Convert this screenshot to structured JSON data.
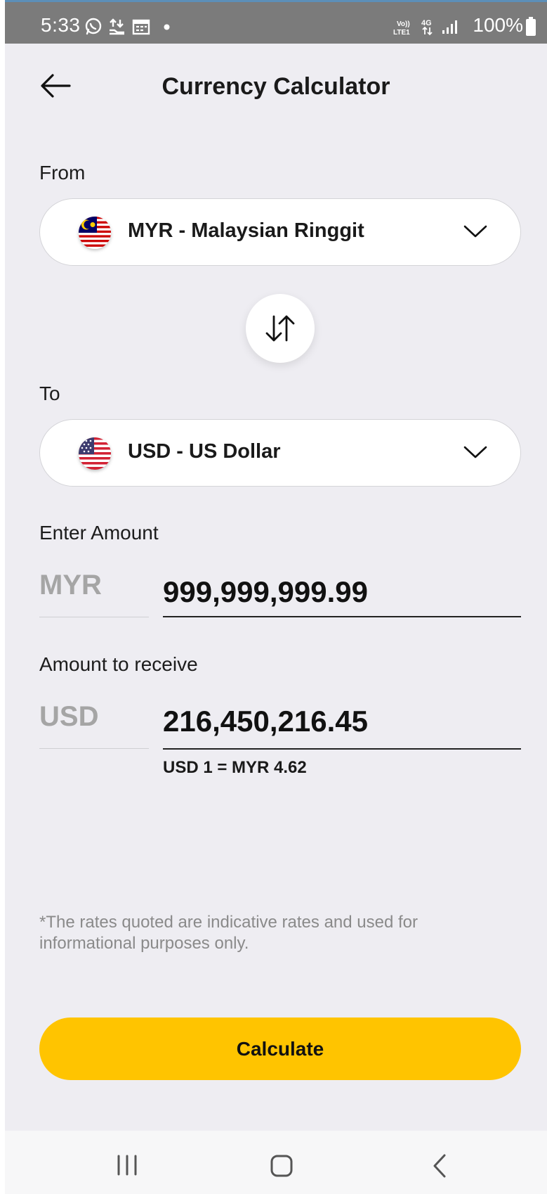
{
  "status_bar": {
    "time": "5:33",
    "network": "4G",
    "volte": "Vo)) LTE1",
    "battery": "100%",
    "icons": [
      "whatsapp-icon",
      "transfer-icon",
      "calendar-icon",
      "dot-icon",
      "volte-icon",
      "4g-icon",
      "signal-icon",
      "battery-icon"
    ]
  },
  "header": {
    "title": "Currency Calculator",
    "back_icon": "arrow-left-icon"
  },
  "from": {
    "label": "From",
    "currency": "MYR - Malaysian Ringgit",
    "flag": "malaysia-flag",
    "dropdown_icon": "chevron-down-icon"
  },
  "swap": {
    "icon": "swap-vertical-icon"
  },
  "to": {
    "label": "To",
    "currency": "USD - US Dollar",
    "flag": "us-flag",
    "dropdown_icon": "chevron-down-icon"
  },
  "enter_amount": {
    "label": "Enter Amount",
    "code": "MYR",
    "value": "999,999,999.99"
  },
  "receive": {
    "label": "Amount to receive",
    "code": "USD",
    "value": "216,450,216.45",
    "rate": "USD 1 = MYR 4.62"
  },
  "disclaimer": "*The rates quoted are indicative rates and used for informational purposes only.",
  "calculate_button": "Calculate",
  "colors": {
    "accent": "#ffc400",
    "background": "#eeedf2",
    "muted_text": "#a5a5a5"
  },
  "nav_bar": {
    "icons": [
      "recent-apps-icon",
      "home-icon",
      "back-nav-icon"
    ]
  }
}
